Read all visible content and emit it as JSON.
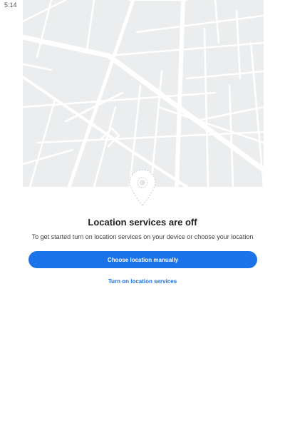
{
  "status_bar": {
    "time": "5:14",
    "icons": [
      "wifi-icon",
      "signal-icon",
      "battery-icon"
    ]
  },
  "empty_state": {
    "title": "Location services are off",
    "message": "To get started turn on location services on your device or choose your location"
  },
  "actions": {
    "primary_label": "Choose location manually",
    "secondary_label": "Turn on location services"
  },
  "colors": {
    "accent": "#1a73e8",
    "map_background": "#ebedee",
    "map_roads": "#ffffff"
  }
}
